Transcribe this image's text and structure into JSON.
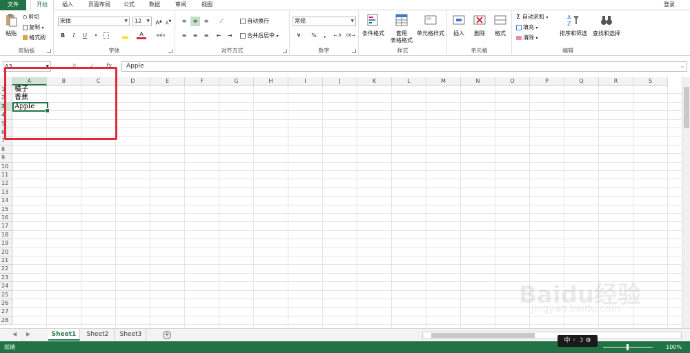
{
  "menu": {
    "file": "文件",
    "tabs": [
      "开始",
      "插入",
      "页面布局",
      "公式",
      "数据",
      "审阅",
      "视图"
    ],
    "login": "登录"
  },
  "ribbon": {
    "clipboard": {
      "label": "剪贴板",
      "paste": "粘贴",
      "cut": "剪切",
      "copy": "复制",
      "format_painter": "格式刷"
    },
    "font": {
      "label": "字体",
      "name": "宋体",
      "size": "12",
      "bold": "B",
      "italic": "I",
      "underline": "U",
      "grow": "A",
      "shrink": "A",
      "font_color": "A",
      "wen": "wén"
    },
    "alignment": {
      "label": "对齐方式",
      "wrap": "自动换行",
      "merge": "合并后居中"
    },
    "number": {
      "label": "数字",
      "format": "常规",
      "currency": "¥",
      "percent": "%",
      "comma": ","
    },
    "styles": {
      "label": "样式",
      "conditional": "条件格式",
      "table": "套用",
      "table2": "表格格式",
      "cell_styles": "单元格样式"
    },
    "cells": {
      "label": "单元格",
      "insert": "插入",
      "delete": "删除",
      "format": "格式"
    },
    "editing": {
      "label": "编辑",
      "autosum": "自动求和",
      "fill": "填充",
      "clear": "清除",
      "sort": "排序和筛选",
      "find": "查找和选择"
    }
  },
  "formula_bar": {
    "name_box": "A3",
    "cancel": "✕",
    "enter": "✓",
    "fx": "fx",
    "content": "Apple"
  },
  "grid": {
    "columns": [
      "A",
      "B",
      "C",
      "D",
      "E",
      "F",
      "G",
      "H",
      "I",
      "J",
      "K",
      "L",
      "M",
      "N",
      "O",
      "P",
      "Q",
      "R",
      "S"
    ],
    "rows": [
      "1",
      "2",
      "3",
      "4",
      "5",
      "6",
      "7",
      "8",
      "9",
      "10",
      "11",
      "12",
      "13",
      "14",
      "15",
      "16",
      "17",
      "18",
      "19",
      "20",
      "21",
      "22",
      "23",
      "24",
      "25",
      "26",
      "27",
      "28"
    ],
    "cells": [
      {
        "row": 1,
        "col": "A",
        "value": "橘子"
      },
      {
        "row": 2,
        "col": "A",
        "value": "香蕉"
      },
      {
        "row": 3,
        "col": "A",
        "value": "Apple"
      }
    ],
    "selected": {
      "row": 3,
      "col": "A"
    }
  },
  "sheets": {
    "tabs": [
      "Sheet1",
      "Sheet2",
      "Sheet3"
    ],
    "active": "Sheet1",
    "add": "+"
  },
  "status": {
    "ready": "就绪",
    "ime": "中 ◦ ☽ ⚙",
    "zoom": "100%"
  },
  "watermark": {
    "text": "Baidu经验",
    "url": "jingyan.baidu.com"
  },
  "colors": {
    "accent": "#217346",
    "highlight": "#e0283a"
  }
}
